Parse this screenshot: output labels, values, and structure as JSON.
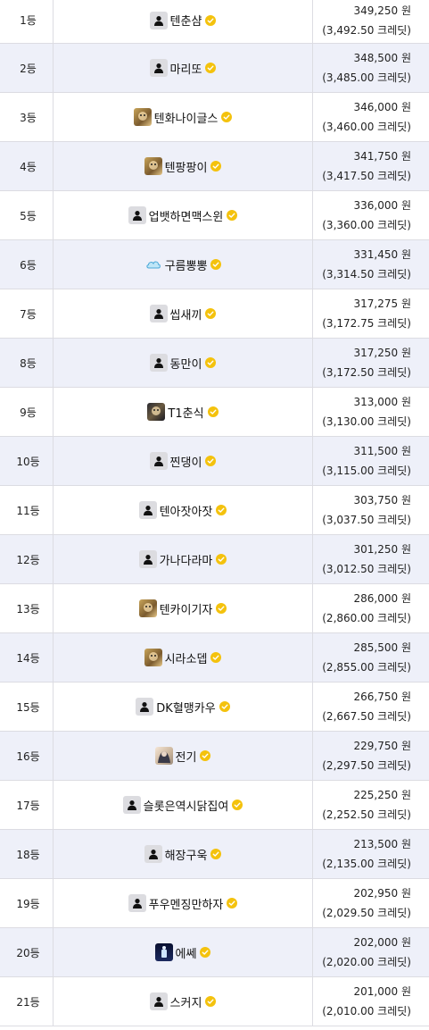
{
  "rows": [
    {
      "rank": "1등",
      "name": "텐춘샴",
      "avatar": "default",
      "won": "349,250 원",
      "credit": "(3,492.50 크레딧)"
    },
    {
      "rank": "2등",
      "name": "마리또",
      "avatar": "default",
      "won": "348,500 원",
      "credit": "(3,485.00 크레딧)"
    },
    {
      "rank": "3등",
      "name": "텐화나이글스",
      "avatar": "photo",
      "won": "346,000 원",
      "credit": "(3,460.00 크레딧)"
    },
    {
      "rank": "4등",
      "name": "텐팡팡이",
      "avatar": "photo",
      "won": "341,750 원",
      "credit": "(3,417.50 크레딧)"
    },
    {
      "rank": "5등",
      "name": "업뱃하면맥스윈",
      "avatar": "default",
      "won": "336,000 원",
      "credit": "(3,360.00 크레딧)"
    },
    {
      "rank": "6등",
      "name": "구름뽕뽕",
      "avatar": "cloud",
      "won": "331,450 원",
      "credit": "(3,314.50 크레딧)"
    },
    {
      "rank": "7등",
      "name": "씹새끼",
      "avatar": "default",
      "won": "317,275 원",
      "credit": "(3,172.75 크레딧)"
    },
    {
      "rank": "8등",
      "name": "동만이",
      "avatar": "default",
      "won": "317,250 원",
      "credit": "(3,172.50 크레딧)"
    },
    {
      "rank": "9등",
      "name": "T1춘식",
      "avatar": "dark",
      "won": "313,000 원",
      "credit": "(3,130.00 크레딧)"
    },
    {
      "rank": "10등",
      "name": "찐댕이",
      "avatar": "default",
      "won": "311,500 원",
      "credit": "(3,115.00 크레딧)"
    },
    {
      "rank": "11등",
      "name": "텐아잣아잣",
      "avatar": "default",
      "won": "303,750 원",
      "credit": "(3,037.50 크레딧)"
    },
    {
      "rank": "12등",
      "name": "가나다라마",
      "avatar": "default",
      "won": "301,250 원",
      "credit": "(3,012.50 크레딧)"
    },
    {
      "rank": "13등",
      "name": "텐카이기자",
      "avatar": "photo",
      "won": "286,000 원",
      "credit": "(2,860.00 크레딧)"
    },
    {
      "rank": "14등",
      "name": "시라소뎁",
      "avatar": "photo",
      "won": "285,500 원",
      "credit": "(2,855.00 크레딧)"
    },
    {
      "rank": "15등",
      "name": "DK혈맹카우",
      "avatar": "default",
      "won": "266,750 원",
      "credit": "(2,667.50 크레딧)"
    },
    {
      "rank": "16등",
      "name": "전기",
      "avatar": "pink",
      "won": "229,750 원",
      "credit": "(2,297.50 크레딧)"
    },
    {
      "rank": "17등",
      "name": "슬롯은역시닭집여",
      "avatar": "default",
      "won": "225,250 원",
      "credit": "(2,252.50 크레딧)"
    },
    {
      "rank": "18등",
      "name": "해장구욱",
      "avatar": "default",
      "won": "213,500 원",
      "credit": "(2,135.00 크레딧)"
    },
    {
      "rank": "19등",
      "name": "푸우멘징만하자",
      "avatar": "default",
      "won": "202,950 원",
      "credit": "(2,029.50 크레딧)"
    },
    {
      "rank": "20등",
      "name": "에쎄",
      "avatar": "night",
      "won": "202,000 원",
      "credit": "(2,020.00 크레딧)"
    },
    {
      "rank": "21등",
      "name": "스커지",
      "avatar": "default",
      "won": "201,000 원",
      "credit": "(2,010.00 크레딧)"
    }
  ],
  "icons": {
    "default_avatar": "user-silhouette-icon",
    "badge": "verified-check-icon",
    "badge_color": "#f4c20d",
    "row_alt_color": "#eef0f9"
  }
}
